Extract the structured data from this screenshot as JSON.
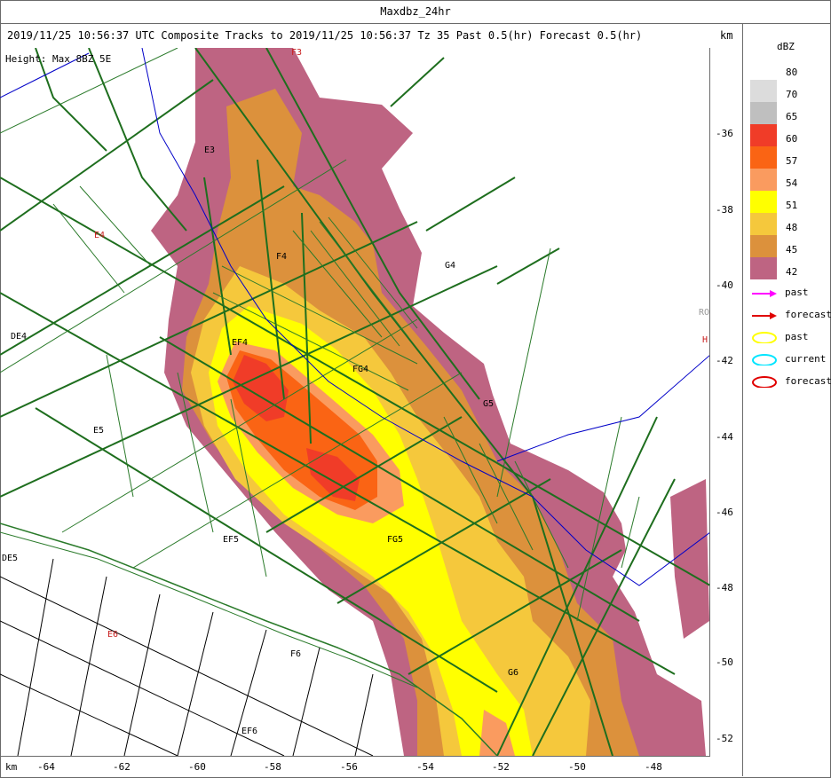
{
  "window": {
    "title": "Maxdbz_24hr"
  },
  "header": {
    "subtitle": "2019/11/25 10:56:37 UTC Composite Tracks to 2019/11/25 10:56:37 Tz 35 Past 0.5(hr) Forecast 0.5(hr)",
    "units": "km",
    "overlay_text": "Height: Max 8BZ 5E"
  },
  "axes": {
    "y_ticks": [
      "-36",
      "-38",
      "-40",
      "-42",
      "-44",
      "-46",
      "-48",
      "-50",
      "-52"
    ],
    "x_ticks": [
      "-64",
      "-62",
      "-60",
      "-58",
      "-56",
      "-54",
      "-52",
      "-50",
      "-48"
    ],
    "x_unit": "km"
  },
  "legend": {
    "title": "dBZ",
    "levels": [
      {
        "label": "80",
        "color": "#dcdcdc"
      },
      {
        "label": "70",
        "color": "#bfbfbf"
      },
      {
        "label": "65",
        "color": "#f03c28"
      },
      {
        "label": "60",
        "color": "#fa6414"
      },
      {
        "label": "57",
        "color": "#fa9b5f"
      },
      {
        "label": "54",
        "color": "#ffff00"
      },
      {
        "label": "51",
        "color": "#f5c83c"
      },
      {
        "label": "48",
        "color": "#dc913c"
      },
      {
        "label": "45",
        "color": "#be6482"
      },
      {
        "label": "42",
        "color": ""
      }
    ],
    "symbols": [
      {
        "label": "past",
        "icon": "magenta-arrow",
        "color": "#ff00ff"
      },
      {
        "label": "forecast",
        "icon": "red-arrow",
        "color": "#e00000"
      },
      {
        "label": "past",
        "icon": "yellow-ellipse",
        "color": "#ffff00"
      },
      {
        "label": "current",
        "icon": "cyan-ellipse",
        "color": "#00e5ff"
      },
      {
        "label": "forecast",
        "icon": "red-ellipse",
        "color": "#e00000"
      }
    ]
  },
  "map_labels": {
    "county": [
      "E3",
      "E4",
      "DE4",
      "F4",
      "EF4",
      "G4",
      "FG4",
      "G5",
      "E5",
      "EF5",
      "DE5",
      "FG5",
      "E6",
      "F6",
      "EF6",
      "G6",
      "F3"
    ],
    "edge": [
      "RO",
      "H"
    ]
  }
}
